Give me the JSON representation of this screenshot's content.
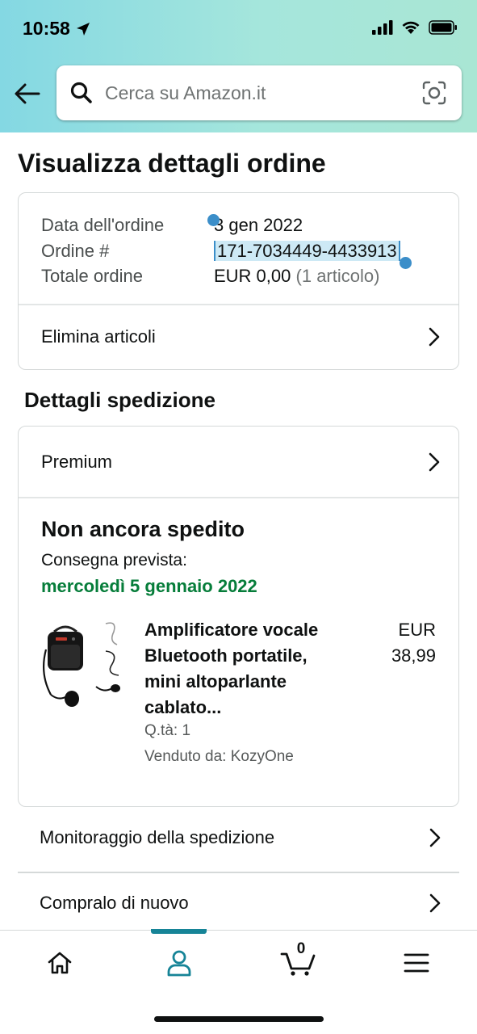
{
  "status_bar": {
    "time": "10:58"
  },
  "search": {
    "placeholder": "Cerca su Amazon.it"
  },
  "page_title": "Visualizza dettagli ordine",
  "order_info": {
    "rows": [
      {
        "label": "Data dell'ordine",
        "value": "3 gen 2022"
      },
      {
        "label": "Ordine #",
        "value": "171-7034449-4433913"
      },
      {
        "label": "Totale ordine",
        "value": "EUR 0,00",
        "extra": "(1 articolo)"
      }
    ],
    "delete_items_label": "Elimina articoli"
  },
  "shipping": {
    "section_title": "Dettagli spedizione",
    "service_label": "Premium",
    "status": "Non ancora spedito",
    "delivery_label": "Consegna prevista:",
    "delivery_date": "mercoledì 5 gennaio 2022",
    "delivery_color": "#067d3a",
    "product": {
      "title": "Amplificatore vocale Bluetooth portatile, mini altoparlante cablato...",
      "currency": "EUR",
      "price": "38,99",
      "quantity": "Q.tà: 1",
      "seller": "Venduto da: KozyOne"
    }
  },
  "actions": [
    {
      "label": "Monitoraggio della spedizione"
    },
    {
      "label": "Compralo di nuovo"
    }
  ],
  "bottom_nav": {
    "items": [
      "home-icon",
      "account-icon",
      "cart-icon",
      "menu-icon"
    ],
    "active": "account-icon",
    "cart_count": "0",
    "accent": "#168497"
  }
}
